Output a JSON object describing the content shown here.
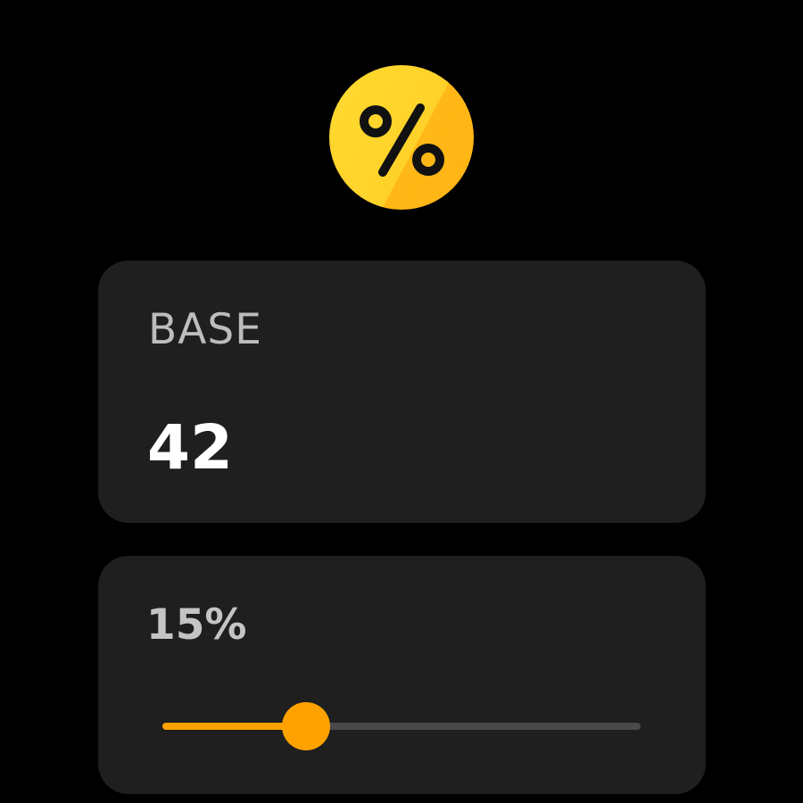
{
  "app_icon": {
    "icon": "percent-icon",
    "glyph": "%",
    "color_light": "#ffd92e",
    "color_dark": "#ffb414"
  },
  "base_card": {
    "label": "BASE",
    "value": "42"
  },
  "percent_card": {
    "label": "15%",
    "slider": {
      "value": 15,
      "min": 0,
      "max": 50,
      "fill_color": "#ffa200",
      "track_color": "#4a4a4a"
    }
  }
}
